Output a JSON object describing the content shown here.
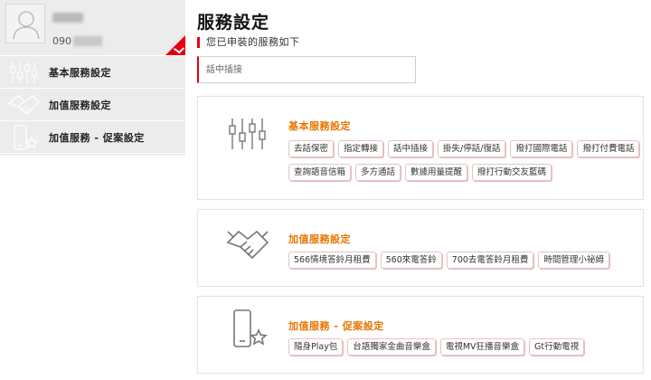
{
  "sidebar": {
    "profile": {
      "phone_prefix": "090"
    },
    "items": [
      {
        "label": "基本服務設定",
        "icon": "equalizer-icon"
      },
      {
        "label": "加值服務設定",
        "icon": "handshake-icon"
      },
      {
        "label": "加值服務 - 促案設定",
        "icon": "phone-star-icon"
      }
    ]
  },
  "main": {
    "title": "服務設定",
    "subtitle": "您已申裝的服務如下",
    "search": {
      "placeholder": "話中插接"
    },
    "sections": [
      {
        "title": "基本服務設定",
        "icon": "equalizer-icon",
        "rows": [
          [
            "去話保密",
            "指定轉接",
            "話中插接",
            "掛失/停話/復話",
            "撥打國際電話",
            "撥打付費電話"
          ],
          [
            "查詢語音信箱",
            "多方通話",
            "數據用量提醒",
            "撥打行動交友藍碼"
          ]
        ]
      },
      {
        "title": "加值服務設定",
        "icon": "handshake-icon",
        "rows": [
          [
            "566情境答鈴月租費",
            "560來電答鈴",
            "700去電答鈴月租費",
            "時間管理小祕姆"
          ]
        ]
      },
      {
        "title": "加值服務 - 促案設定",
        "icon": "phone-star-icon",
        "rows": [
          [
            "隨身Play包",
            "台語獨家金曲音樂盒",
            "電視MV狂播音樂盒",
            "Gt行動電視"
          ]
        ]
      }
    ]
  },
  "colors": {
    "accent_red": "#e60012",
    "section_title_orange": "#e87500",
    "sidebar_bg": "#ececec"
  }
}
